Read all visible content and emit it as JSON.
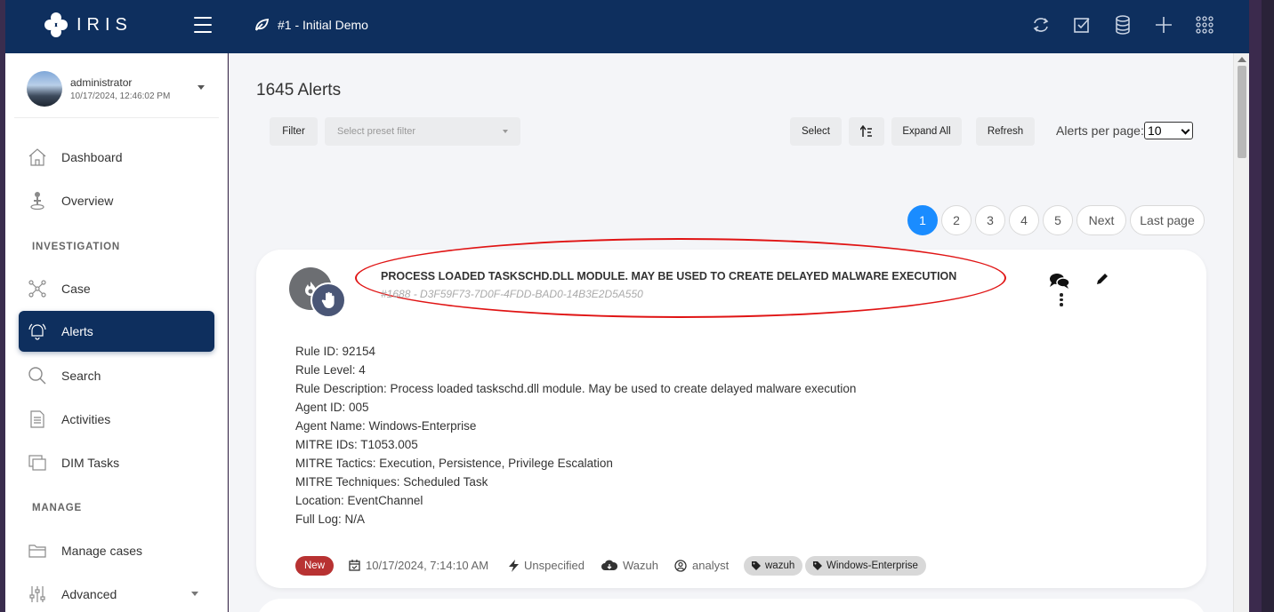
{
  "app": {
    "name": "IRIS",
    "case_title": "#1 - Initial Demo"
  },
  "user": {
    "name": "administrator",
    "datetime": "10/17/2024, 12:46:02 PM"
  },
  "sidebar": {
    "items": [
      {
        "label": "Dashboard",
        "icon": "home-icon"
      },
      {
        "label": "Overview",
        "icon": "person-pin-icon"
      },
      {
        "label": "Case",
        "icon": "network-icon"
      },
      {
        "label": "Alerts",
        "icon": "bell-icon",
        "active": true
      },
      {
        "label": "Search",
        "icon": "search-icon"
      },
      {
        "label": "Activities",
        "icon": "document-icon"
      },
      {
        "label": "DIM Tasks",
        "icon": "copy-icon"
      },
      {
        "label": "Manage cases",
        "icon": "folder-icon"
      },
      {
        "label": "Advanced",
        "icon": "sliders-icon"
      }
    ],
    "sections": {
      "investigation": "INVESTIGATION",
      "manage": "MANAGE"
    }
  },
  "main": {
    "title": "1645 Alerts",
    "toolbar": {
      "filter": "Filter",
      "preset_placeholder": "Select preset filter",
      "select": "Select",
      "expand_all": "Expand All",
      "refresh": "Refresh",
      "per_page_label": "Alerts per page:",
      "per_page_value": "10"
    },
    "pagination": {
      "pages": [
        "1",
        "2",
        "3",
        "4",
        "5"
      ],
      "current": "1",
      "next": "Next",
      "last": "Last page"
    }
  },
  "alert": {
    "title": "PROCESS LOADED TASKSCHD.DLL MODULE. MAY BE USED TO CREATE DELAYED MALWARE EXECUTION",
    "id": "#1688 - D3F59F73-7D0F-4FDD-BAD0-14B3E2D5A550",
    "details": [
      "Rule ID: 92154",
      "Rule Level: 4",
      "Rule Description: Process loaded taskschd.dll module. May be used to create delayed malware execution",
      "Agent ID: 005",
      "Agent Name: Windows-Enterprise",
      "MITRE IDs: T1053.005",
      "MITRE Tactics: Execution, Persistence, Privilege Escalation",
      "MITRE Techniques: Scheduled Task",
      "Location: EventChannel",
      "Full Log: N/A"
    ],
    "status": "New",
    "date": "10/17/2024, 7:14:10 AM",
    "severity": "Unspecified",
    "source": "Wazuh",
    "owner": "analyst",
    "tags": [
      "wazuh",
      "Windows-Enterprise"
    ],
    "colors": {
      "status_badge": "#b83232",
      "highlight_ring": "#e01414"
    }
  },
  "colors": {
    "topbar": "#0e2f5e",
    "active_nav": "#0e2f5e",
    "page_active": "#1a8cff"
  }
}
